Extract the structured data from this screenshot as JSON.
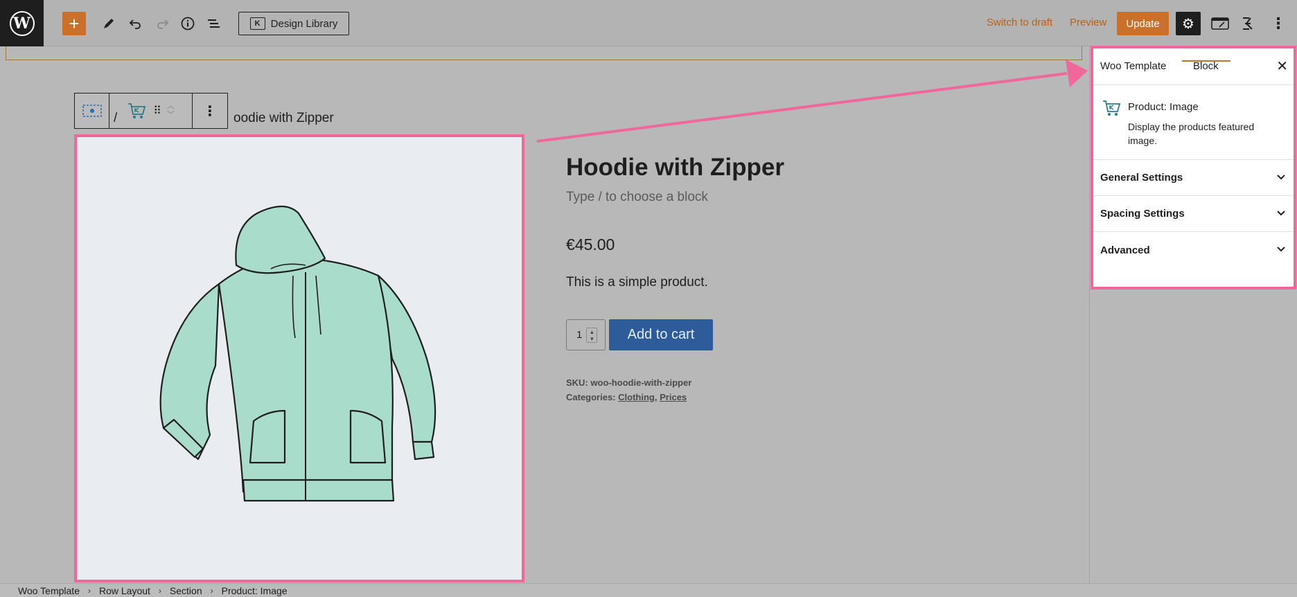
{
  "toolbar": {
    "design_library_label": "Design Library",
    "switch_to_draft_label": "Switch to draft",
    "preview_label": "Preview",
    "update_label": "Update"
  },
  "canvas": {
    "breadcrumb_title_fragment": "/",
    "breadcrumb_title_text": "oodie with Zipper",
    "product_title": "Hoodie with Zipper",
    "block_placeholder": "Type / to choose a block",
    "price": "€45.00",
    "description": "This is a simple product.",
    "quantity": "1",
    "add_to_cart_label": "Add to cart",
    "sku_label": "SKU:",
    "sku_value": "woo-hoodie-with-zipper",
    "categories_label": "Categories:",
    "categories": [
      "Clothing",
      "Prices"
    ],
    "categories_separator": ","
  },
  "sidebar": {
    "tabs": [
      {
        "label": "Woo Template"
      },
      {
        "label": "Block"
      }
    ],
    "block_title": "Product: Image",
    "block_description": "Display the products featured image.",
    "sections": [
      {
        "label": "General Settings"
      },
      {
        "label": "Spacing Settings"
      },
      {
        "label": "Advanced"
      }
    ]
  },
  "footer": {
    "breadcrumbs": [
      "Woo Template",
      "Row Layout",
      "Section",
      "Product: Image"
    ]
  },
  "colors": {
    "accent_orange": "#c9712a",
    "highlight_pink": "#f0679b",
    "cart_blue": "#2e5b9a",
    "hoodie_mint": "#a9dccb"
  }
}
